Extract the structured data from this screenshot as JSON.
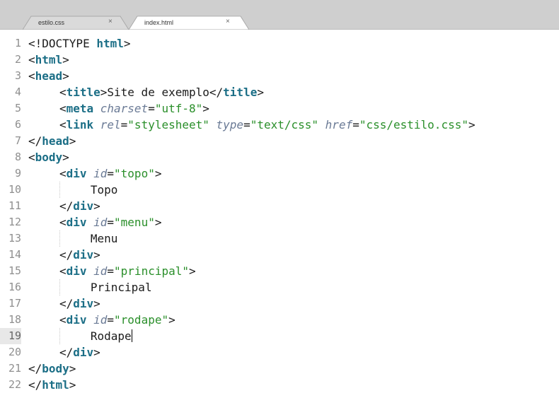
{
  "tabs": [
    {
      "label": "estilo.css",
      "close": "×",
      "active": false
    },
    {
      "label": "index.html",
      "close": "×",
      "active": true
    }
  ],
  "lines": [
    {
      "n": "1",
      "indent": 0,
      "tokens": [
        [
          "p",
          "<!DOCTYPE "
        ],
        [
          "k",
          "html"
        ],
        [
          "p",
          ">"
        ]
      ]
    },
    {
      "n": "2",
      "indent": 0,
      "tokens": [
        [
          "p",
          "<"
        ],
        [
          "k",
          "html"
        ],
        [
          "p",
          ">"
        ]
      ]
    },
    {
      "n": "3",
      "indent": 0,
      "tokens": [
        [
          "p",
          "<"
        ],
        [
          "k",
          "head"
        ],
        [
          "p",
          ">"
        ]
      ]
    },
    {
      "n": "4",
      "indent": 1,
      "tokens": [
        [
          "p",
          "<"
        ],
        [
          "k",
          "title"
        ],
        [
          "p",
          ">"
        ],
        [
          "t",
          "Site de exemplo"
        ],
        [
          "p",
          "</"
        ],
        [
          "k",
          "title"
        ],
        [
          "p",
          ">"
        ]
      ]
    },
    {
      "n": "5",
      "indent": 1,
      "tokens": [
        [
          "p",
          "<"
        ],
        [
          "k",
          "meta"
        ],
        [
          "t",
          " "
        ],
        [
          "a",
          "charset"
        ],
        [
          "p",
          "="
        ],
        [
          "s",
          "\"utf-8\""
        ],
        [
          "p",
          ">"
        ]
      ]
    },
    {
      "n": "6",
      "indent": 1,
      "tokens": [
        [
          "p",
          "<"
        ],
        [
          "k",
          "link"
        ],
        [
          "t",
          " "
        ],
        [
          "a",
          "rel"
        ],
        [
          "p",
          "="
        ],
        [
          "s",
          "\"stylesheet\""
        ],
        [
          "t",
          " "
        ],
        [
          "a",
          "type"
        ],
        [
          "p",
          "="
        ],
        [
          "s",
          "\"text/css\""
        ],
        [
          "t",
          " "
        ],
        [
          "a",
          "href"
        ],
        [
          "p",
          "="
        ],
        [
          "s",
          "\"css/estilo.css\""
        ],
        [
          "p",
          ">"
        ]
      ]
    },
    {
      "n": "7",
      "indent": 0,
      "tokens": [
        [
          "p",
          "</"
        ],
        [
          "k",
          "head"
        ],
        [
          "p",
          ">"
        ]
      ]
    },
    {
      "n": "8",
      "indent": 0,
      "tokens": [
        [
          "p",
          "<"
        ],
        [
          "k",
          "body"
        ],
        [
          "p",
          ">"
        ]
      ]
    },
    {
      "n": "9",
      "indent": 1,
      "tokens": [
        [
          "p",
          "<"
        ],
        [
          "k",
          "div"
        ],
        [
          "t",
          " "
        ],
        [
          "a",
          "id"
        ],
        [
          "p",
          "="
        ],
        [
          "s",
          "\"topo\""
        ],
        [
          "p",
          ">"
        ]
      ]
    },
    {
      "n": "10",
      "indent": 2,
      "tokens": [
        [
          "t",
          "Topo"
        ]
      ]
    },
    {
      "n": "11",
      "indent": 1,
      "tokens": [
        [
          "p",
          "</"
        ],
        [
          "k",
          "div"
        ],
        [
          "p",
          ">"
        ]
      ]
    },
    {
      "n": "12",
      "indent": 1,
      "tokens": [
        [
          "p",
          "<"
        ],
        [
          "k",
          "div"
        ],
        [
          "t",
          " "
        ],
        [
          "a",
          "id"
        ],
        [
          "p",
          "="
        ],
        [
          "s",
          "\"menu\""
        ],
        [
          "p",
          ">"
        ]
      ]
    },
    {
      "n": "13",
      "indent": 2,
      "tokens": [
        [
          "t",
          "Menu"
        ]
      ]
    },
    {
      "n": "14",
      "indent": 1,
      "tokens": [
        [
          "p",
          "</"
        ],
        [
          "k",
          "div"
        ],
        [
          "p",
          ">"
        ]
      ]
    },
    {
      "n": "15",
      "indent": 1,
      "tokens": [
        [
          "p",
          "<"
        ],
        [
          "k",
          "div"
        ],
        [
          "t",
          " "
        ],
        [
          "a",
          "id"
        ],
        [
          "p",
          "="
        ],
        [
          "s",
          "\"principal\""
        ],
        [
          "p",
          ">"
        ]
      ]
    },
    {
      "n": "16",
      "indent": 2,
      "tokens": [
        [
          "t",
          "Principal"
        ]
      ]
    },
    {
      "n": "17",
      "indent": 1,
      "tokens": [
        [
          "p",
          "</"
        ],
        [
          "k",
          "div"
        ],
        [
          "p",
          ">"
        ]
      ]
    },
    {
      "n": "18",
      "indent": 1,
      "tokens": [
        [
          "p",
          "<"
        ],
        [
          "k",
          "div"
        ],
        [
          "t",
          " "
        ],
        [
          "a",
          "id"
        ],
        [
          "p",
          "="
        ],
        [
          "s",
          "\"rodape\""
        ],
        [
          "p",
          ">"
        ]
      ]
    },
    {
      "n": "19",
      "indent": 2,
      "tokens": [
        [
          "t",
          "Rodape"
        ]
      ],
      "active": true,
      "cursor": true
    },
    {
      "n": "20",
      "indent": 1,
      "tokens": [
        [
          "p",
          "</"
        ],
        [
          "k",
          "div"
        ],
        [
          "p",
          ">"
        ]
      ]
    },
    {
      "n": "21",
      "indent": 0,
      "tokens": [
        [
          "p",
          "</"
        ],
        [
          "k",
          "body"
        ],
        [
          "p",
          ">"
        ]
      ]
    },
    {
      "n": "22",
      "indent": 0,
      "tokens": [
        [
          "p",
          "</"
        ],
        [
          "k",
          "html"
        ],
        [
          "p",
          ">"
        ]
      ]
    }
  ],
  "colors": {
    "tag": "#1b6e86",
    "attribute": "#6a7a95",
    "string": "#2a8f2a",
    "text": "#1b1b1b",
    "gutter": "#8f8f8f",
    "tabbar": "#cfcfcf"
  }
}
